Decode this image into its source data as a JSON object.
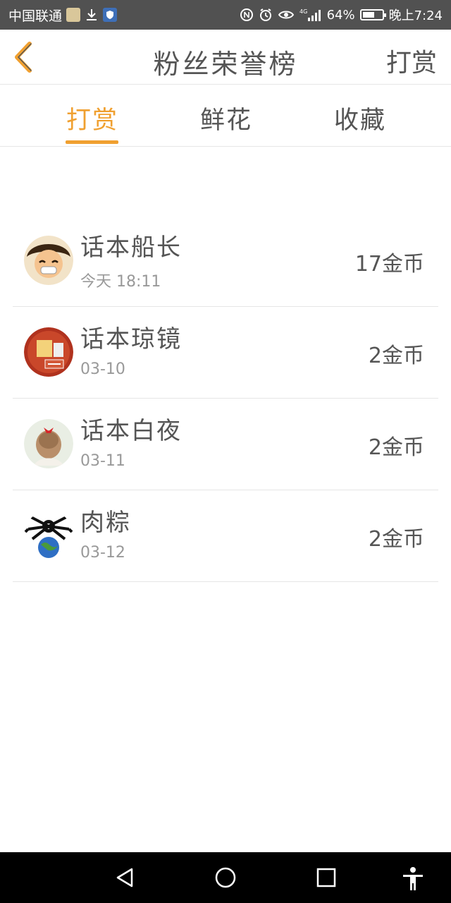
{
  "status_bar": {
    "carrier": "中国联通",
    "network": "4G",
    "battery_percent": "64%",
    "time": "晚上7:24",
    "battery_level": 0.64
  },
  "header": {
    "back_icon": "chevron-left-icon",
    "title": "粉丝荣誉榜",
    "action_label": "打赏",
    "accent_color": "#f0a030"
  },
  "tabs": [
    {
      "label": "打赏",
      "active": true
    },
    {
      "label": "鲜花",
      "active": false
    },
    {
      "label": "收藏",
      "active": false
    }
  ],
  "fans": [
    {
      "name": "话本船长",
      "date": "今天 18:11",
      "amount": "17金币"
    },
    {
      "name": "话本琼镜",
      "date": "03-10",
      "amount": "2金币"
    },
    {
      "name": "话本白夜",
      "date": "03-11",
      "amount": "2金币"
    },
    {
      "name": "肉粽",
      "date": "03-12",
      "amount": "2金币"
    }
  ],
  "bottom_nav": {
    "back": "triangle-back-icon",
    "home": "circle-home-icon",
    "recents": "square-recents-icon",
    "accessibility": "accessibility-icon"
  }
}
